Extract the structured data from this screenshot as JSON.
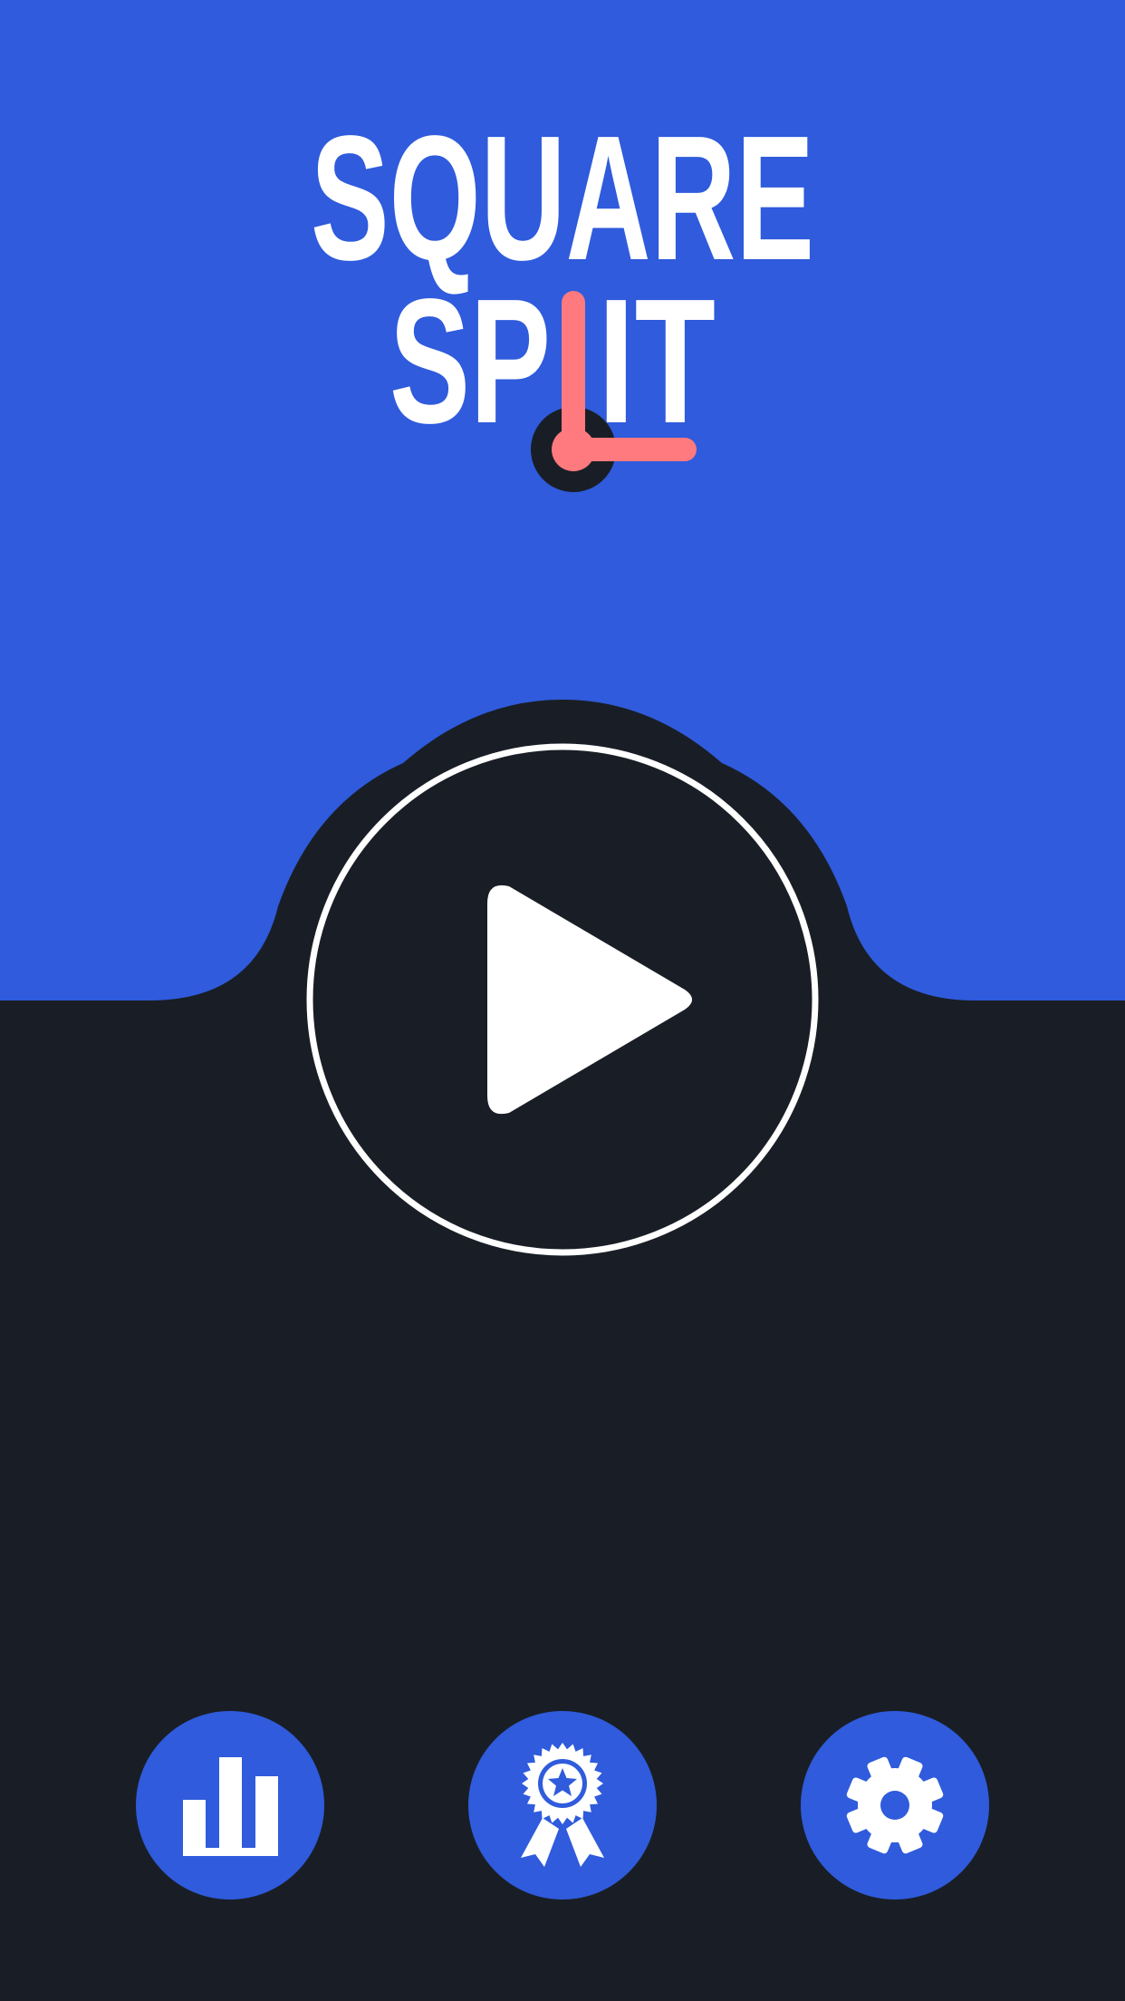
{
  "app": {
    "title_line1": "SQUARE",
    "title_line2_prefix": "SP",
    "title_line2_suffix": "IT"
  },
  "colors": {
    "top_background": "#2f5bdc",
    "bottom_background": "#191e26",
    "title_text": "#ffffff",
    "logo_accent": "#ff7a7e",
    "button_fill": "#2f5bdc",
    "icon_fill": "#ffffff"
  },
  "icons": {
    "play": "play-icon",
    "stats": "bar-chart-icon",
    "achievements": "award-ribbon-icon",
    "settings": "gear-icon"
  }
}
